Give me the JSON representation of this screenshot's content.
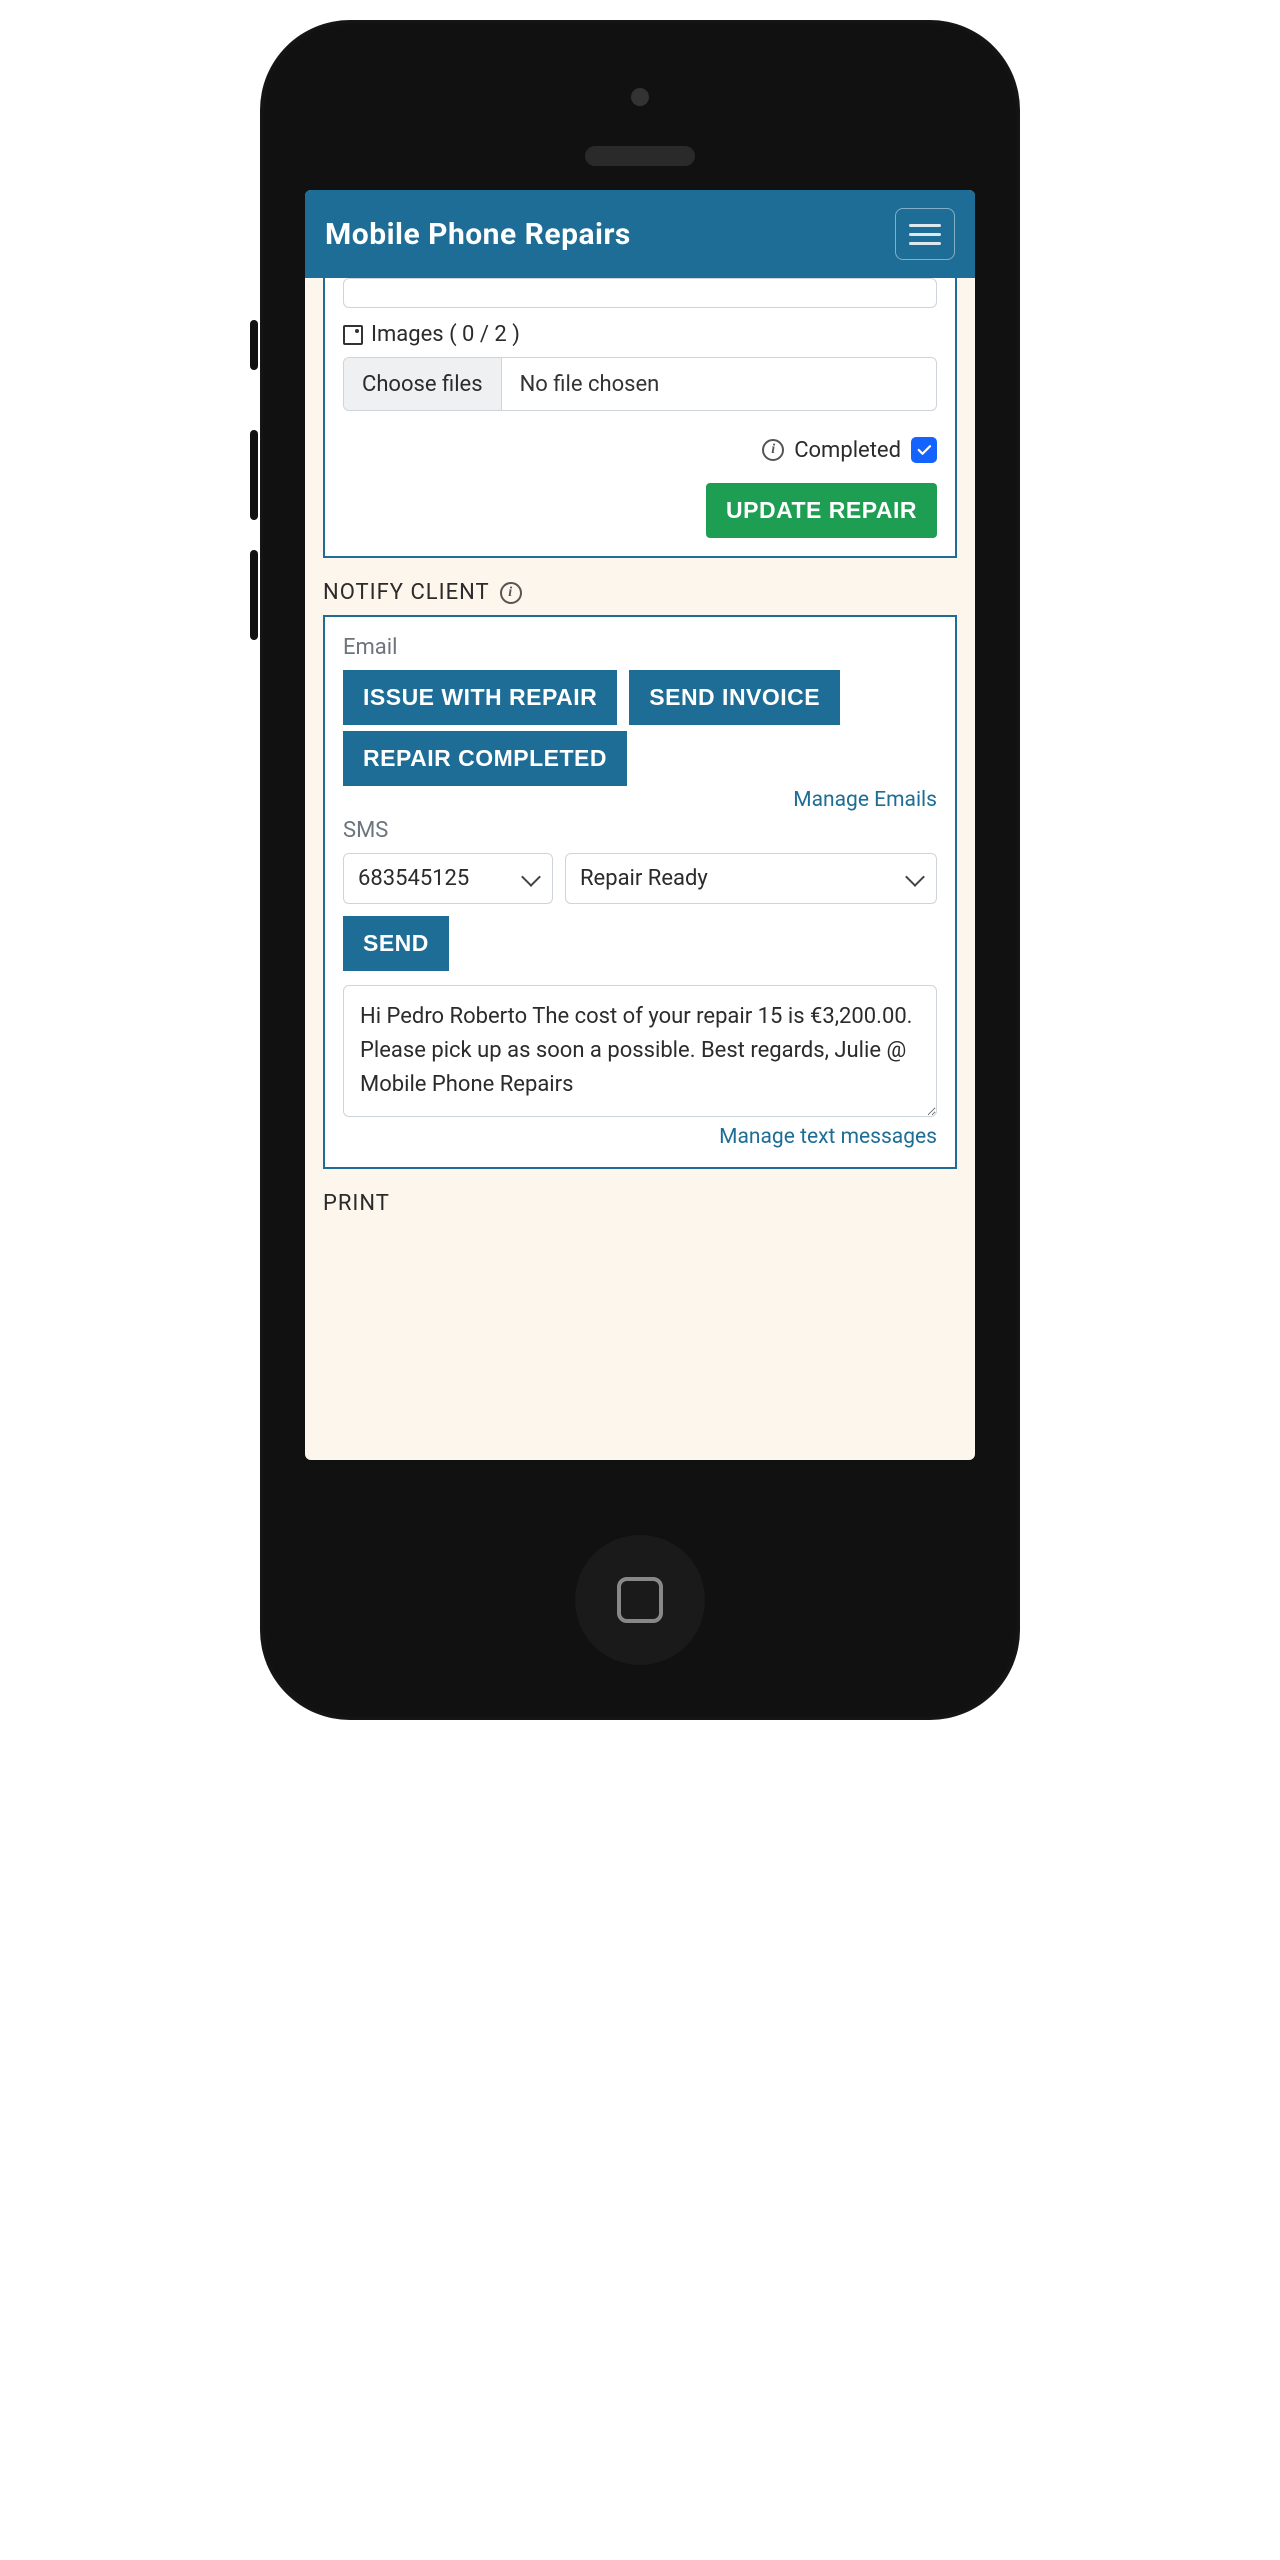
{
  "navbar": {
    "title": "Mobile Phone Repairs"
  },
  "repair": {
    "images_label": "Images ( 0 / 2 )",
    "choose_files": "Choose files",
    "no_file": "No file chosen",
    "completed_label": "Completed",
    "completed_checked": true,
    "update_button": "UPDATE REPAIR"
  },
  "notify": {
    "header": "NOTIFY CLIENT",
    "email_label": "Email",
    "buttons": {
      "issue": "ISSUE WITH REPAIR",
      "invoice": "SEND INVOICE",
      "completed": "REPAIR COMPLETED"
    },
    "manage_emails": "Manage Emails",
    "sms_label": "SMS",
    "sms_phone": "683545125",
    "sms_template": "Repair Ready",
    "send_button": "SEND",
    "sms_body": "Hi Pedro Roberto The cost of your repair 15 is €3,200.00. Please pick up as soon a possible. Best regards, Julie @ Mobile Phone Repairs",
    "manage_sms": "Manage text messages"
  },
  "print": {
    "header": "PRINT"
  }
}
